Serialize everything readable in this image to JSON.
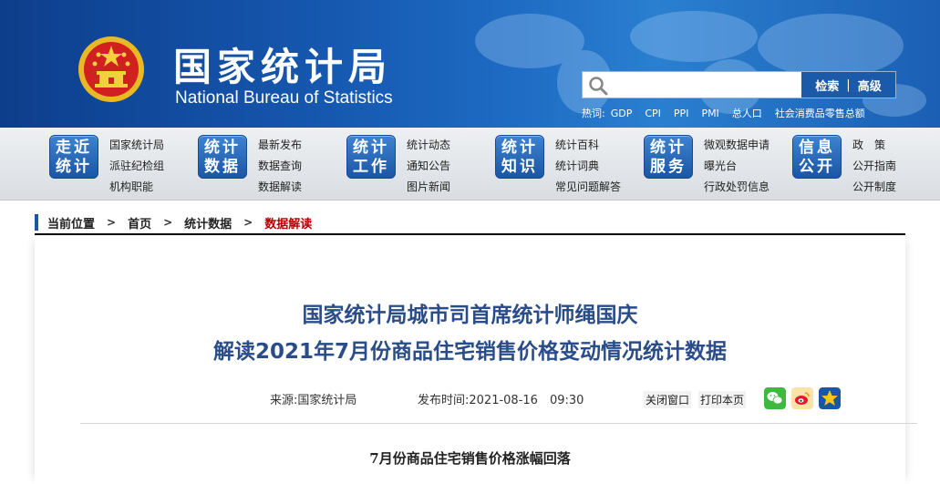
{
  "header": {
    "title_cn": "国家统计局",
    "title_en": "National Bureau of Statistics",
    "emblem_icon": "national-emblem-icon",
    "search": {
      "placeholder": "",
      "search_label": "检索",
      "separator": "|",
      "advanced_label": "高级"
    },
    "hotwords_label": "热词:",
    "hotwords": [
      "GDP",
      "CPI",
      "PPI",
      "PMI",
      "总人口",
      "社会消费品零售总额"
    ]
  },
  "nav": [
    {
      "badge": [
        "走近",
        "统计"
      ],
      "links": [
        "国家统计局",
        "派驻纪检组",
        "机构职能"
      ]
    },
    {
      "badge": [
        "统计",
        "数据"
      ],
      "links": [
        "最新发布",
        "数据查询",
        "数据解读"
      ]
    },
    {
      "badge": [
        "统计",
        "工作"
      ],
      "links": [
        "统计动态",
        "通知公告",
        "图片新闻"
      ]
    },
    {
      "badge": [
        "统计",
        "知识"
      ],
      "links": [
        "统计百科",
        "统计词典",
        "常见问题解答"
      ]
    },
    {
      "badge": [
        "统计",
        "服务"
      ],
      "links": [
        "微观数据申请",
        "曝光台",
        "行政处罚信息"
      ]
    },
    {
      "badge": [
        "信息",
        "公开"
      ],
      "links": [
        "政　策",
        "公开指南",
        "公开制度"
      ]
    }
  ],
  "breadcrumb": {
    "items": [
      "当前位置",
      "首页",
      "统计数据"
    ],
    "current": "数据解读",
    "separator": ">"
  },
  "article": {
    "title_line1": "国家统计局城市司首席统计师绳国庆",
    "title_line2": "解读2021年7月份商品住宅销售价格变动情况统计数据",
    "source_label": "来源:",
    "source_value": "国家统计局",
    "date_label": "发布时间:",
    "date_value": "2021-08-16　09:30",
    "close_window": "关闭窗口",
    "print_page": "打印本页",
    "share_icons": [
      "wechat-icon",
      "weibo-icon",
      "favorite-star-icon"
    ],
    "share_colors": {
      "wechat": "#3fb83f",
      "weibo": "#e6162d",
      "star": "#1a56a5"
    },
    "subheading": "7月份商品住宅销售价格涨幅回落"
  },
  "colors": {
    "header_blue": "#1658b0",
    "title_blue": "#2a4d8a",
    "breadcrumb_current": "#b40000"
  }
}
